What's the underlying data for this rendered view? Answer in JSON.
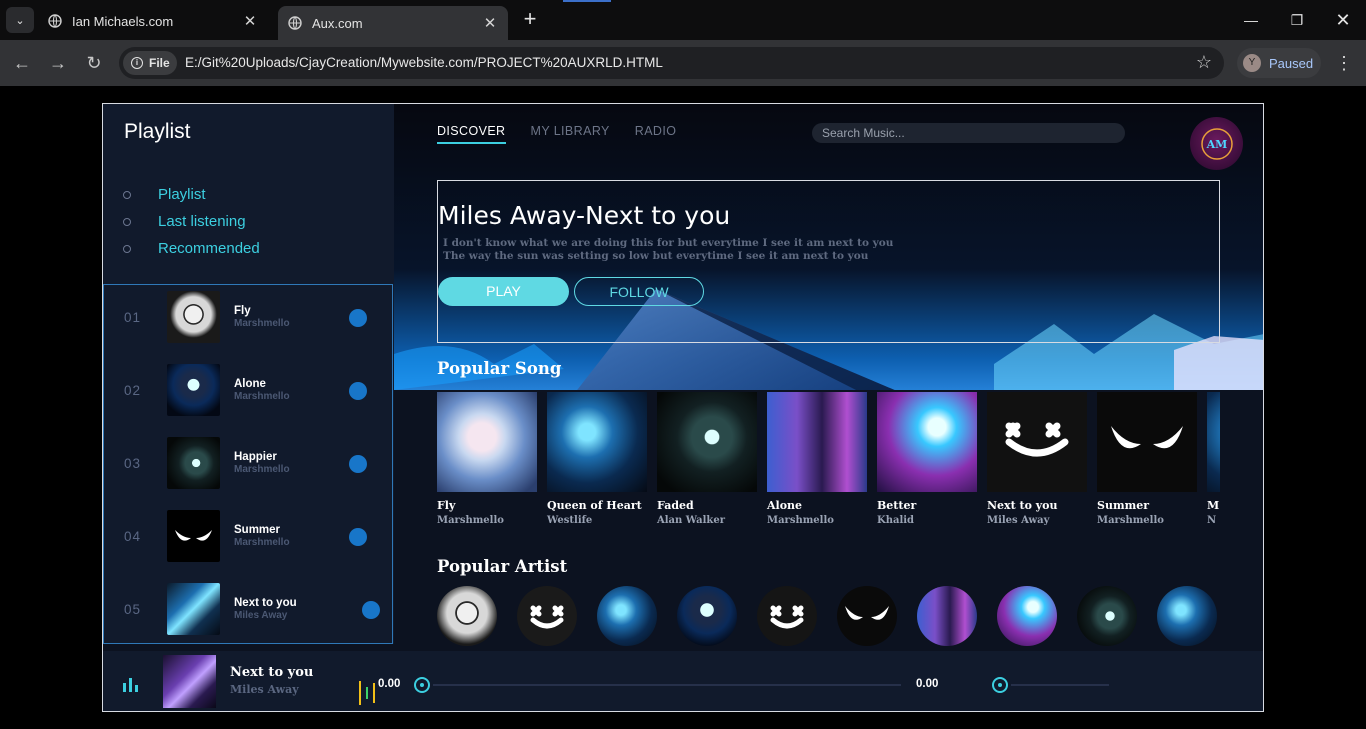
{
  "browser": {
    "tabs": [
      {
        "title": "Ian Michaels.com",
        "active": false
      },
      {
        "title": "Aux.com",
        "active": true
      }
    ],
    "url_chip": "File",
    "url": "E:/Git%20Uploads/CjayCreation/Mywebsite.com/PROJECT%20AUXRLD.HTML",
    "profile_initial": "Y",
    "profile_status": "Paused"
  },
  "sidebar": {
    "title": "Playlist",
    "nav": [
      {
        "label": "Playlist"
      },
      {
        "label": "Last listening"
      },
      {
        "label": "Recommended"
      }
    ],
    "playlist": [
      {
        "num": "01",
        "name": "Fly",
        "artist": "Marshmello"
      },
      {
        "num": "02",
        "name": "Alone",
        "artist": "Marshmello"
      },
      {
        "num": "03",
        "name": "Happier",
        "artist": "Marshmello"
      },
      {
        "num": "04",
        "name": "Summer",
        "artist": "Marshmello"
      },
      {
        "num": "05",
        "name": "Next to you",
        "artist": "Miles Away"
      }
    ]
  },
  "main": {
    "nav": [
      {
        "label": "DISCOVER",
        "active": true
      },
      {
        "label": "MY LIBRARY",
        "active": false
      },
      {
        "label": "RADIO",
        "active": false
      }
    ],
    "search_placeholder": "Search Music...",
    "logo_text": "AM",
    "hero": {
      "title": "Miles Away-Next to you",
      "line1": "I don't know what we are doing this for but everytime I see it am next to you",
      "line2": "The way the sun was setting so low but everytime I see it am next to you",
      "play_label": "PLAY",
      "follow_label": "FOLLOW"
    },
    "popular_song_title": "Popular Song",
    "songs": [
      {
        "name": "Fly",
        "artist": "Marshmello"
      },
      {
        "name": "Queen of Heart",
        "artist": "Westlife"
      },
      {
        "name": "Faded",
        "artist": "Alan Walker"
      },
      {
        "name": "Alone",
        "artist": "Marshmello"
      },
      {
        "name": "Better",
        "artist": "Khalid"
      },
      {
        "name": "Next to you",
        "artist": "Miles Away"
      },
      {
        "name": "Summer",
        "artist": "Marshmello"
      },
      {
        "name": "M",
        "artist": "N"
      }
    ],
    "popular_artist_title": "Popular Artist",
    "artist_count": 10
  },
  "player": {
    "title": "Next to you",
    "artist": "Miles Away",
    "current_time": "0.00",
    "volume_value": "0.00"
  },
  "colors": {
    "accent": "#3ccfe0",
    "page_bg": "#0c1220",
    "panel_bg": "#111a2c",
    "playlist_button": "#1876c9"
  }
}
